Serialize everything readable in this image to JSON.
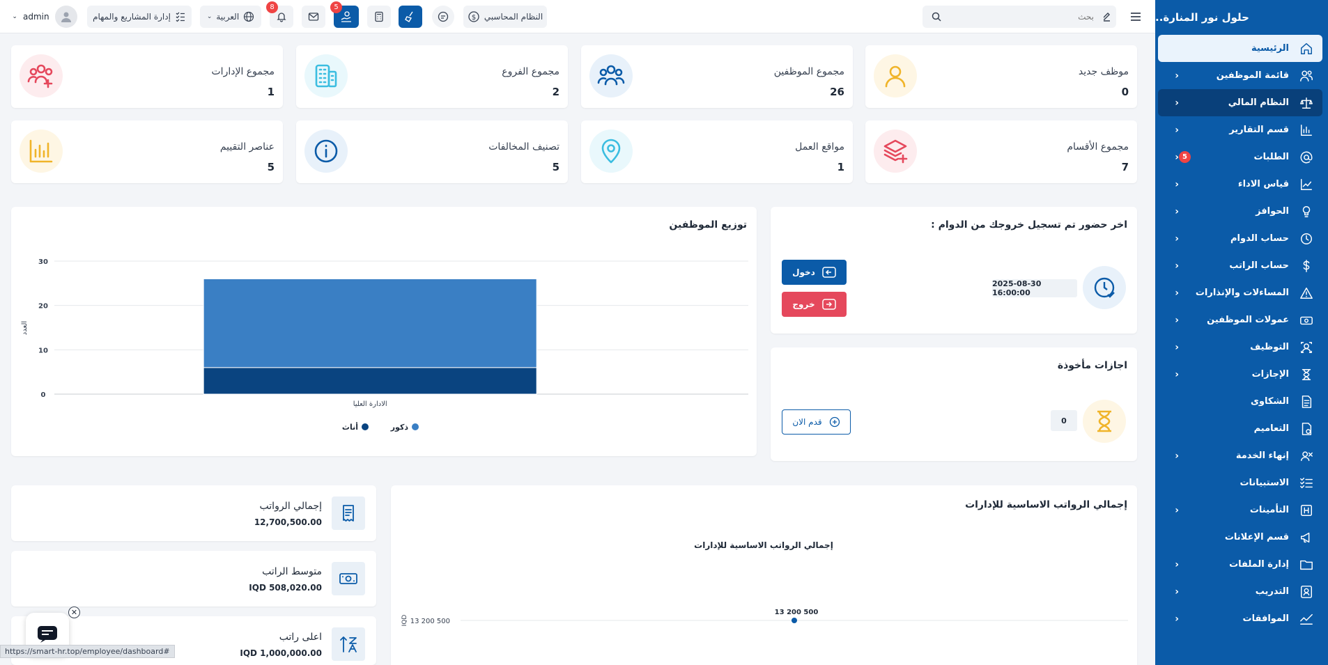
{
  "sidebar": {
    "brand": "حلول نور المنارة..",
    "items": [
      {
        "label": "الرئيسية",
        "icon": "home-icon",
        "chevron": false,
        "state": "active"
      },
      {
        "label": "قائمة الموظفين",
        "icon": "users-icon",
        "chevron": true
      },
      {
        "label": "النظام المالي",
        "icon": "scale-icon",
        "chevron": true,
        "state": "selected"
      },
      {
        "label": "قسم التقارير",
        "icon": "report-chart-icon",
        "chevron": true
      },
      {
        "label": "الطلبات",
        "icon": "at-icon",
        "chevron": true,
        "badge": "5"
      },
      {
        "label": "قياس الاداء",
        "icon": "trend-up-icon",
        "chevron": true
      },
      {
        "label": "الحوافز",
        "icon": "bulb-icon",
        "chevron": true
      },
      {
        "label": "حساب الدوام",
        "icon": "clock-icon",
        "chevron": true
      },
      {
        "label": "حساب الراتب",
        "icon": "dollar-icon",
        "chevron": true
      },
      {
        "label": "المساءلات والإنذارات",
        "icon": "warning-icon",
        "chevron": true
      },
      {
        "label": "عمولات الموظفين",
        "icon": "cash-icon",
        "chevron": true
      },
      {
        "label": "التوظيف",
        "icon": "hire-icon",
        "chevron": true
      },
      {
        "label": "الإجازات",
        "icon": "hourglass-icon",
        "chevron": true
      },
      {
        "label": "الشكاوى",
        "icon": "document-icon",
        "chevron": false
      },
      {
        "label": "التعاميم",
        "icon": "memo-icon",
        "chevron": false
      },
      {
        "label": "إنهاء الخدمة",
        "icon": "end-service-icon",
        "chevron": true
      },
      {
        "label": "الاستبيانات",
        "icon": "checklist-icon",
        "chevron": false
      },
      {
        "label": "التأمينات",
        "icon": "insurance-icon",
        "chevron": true
      },
      {
        "label": "قسم الإعلانات",
        "icon": "megaphone-icon",
        "chevron": false
      },
      {
        "label": "إدارة الملفات",
        "icon": "folder-icon",
        "chevron": true
      },
      {
        "label": "التدريب",
        "icon": "training-icon",
        "chevron": true
      },
      {
        "label": "الموافقات",
        "icon": "approval-icon",
        "chevron": true
      }
    ]
  },
  "topbar": {
    "search_placeholder": "بحث",
    "accounting_label": "النظام المحاسبي",
    "language_label": "العربية",
    "projects_label": "إدارة المشاريع والمهام",
    "user_label": "admin",
    "notifications_count": "8",
    "tasks_count": "5"
  },
  "stats": [
    {
      "title": "موظف جديد",
      "value": "0",
      "icon": "user-icon",
      "bg": "#fef6e4",
      "color": "#f0b429"
    },
    {
      "title": "مجموع الموظفين",
      "value": "26",
      "icon": "team-icon",
      "bg": "#e8f1fa",
      "color": "#0b5ba8"
    },
    {
      "title": "مجموع الفروع",
      "value": "2",
      "icon": "building-icon",
      "bg": "#e9f8fc",
      "color": "#3bbde0"
    },
    {
      "title": "مجموع الإدارات",
      "value": "1",
      "icon": "team-add-icon",
      "bg": "#fdecee",
      "color": "#e5485c"
    },
    {
      "title": "مجموع الأقسام",
      "value": "7",
      "icon": "layers-add-icon",
      "bg": "#fdecee",
      "color": "#e5485c"
    },
    {
      "title": "مواقع العمل",
      "value": "1",
      "icon": "map-pin-icon",
      "bg": "#e9f8fc",
      "color": "#3bbde0"
    },
    {
      "title": "تصنيف المخالفات",
      "value": "5",
      "icon": "info-icon",
      "bg": "#e8f1fa",
      "color": "#0b5ba8"
    },
    {
      "title": "عناصر التقييم",
      "value": "5",
      "icon": "bar-chart-icon",
      "bg": "#fef6e4",
      "color": "#f0b429"
    }
  ],
  "attendance": {
    "title": "اخر حضور تم تسجيل خروجك من الدوام :",
    "datetime": "2025-08-30 16:00:00",
    "checkin_label": "دخول",
    "checkout_label": "خروج"
  },
  "leaves": {
    "title": "اجازات مأخوذة",
    "count": "0",
    "apply_label": "قدم الان"
  },
  "employee_distribution": {
    "title": "توزيع الموظفين"
  },
  "salary_cards": [
    {
      "title": "إجمالي الرواتب",
      "value": "12,700,500.00",
      "icon": "receipt-icon"
    },
    {
      "title": "متوسط الراتب",
      "value": "IQD 508,020.00",
      "icon": "money-icon"
    },
    {
      "title": "اعلى راتب",
      "value": "IQD 1,000,000.00",
      "icon": "sort-up-icon"
    }
  ],
  "salary_panel": {
    "title": "إجمالي الرواتب الاساسية للإدارات"
  },
  "status_url": "https://smart-hr.top/employee/dashboard#",
  "chart_data": [
    {
      "type": "bar",
      "stacked": true,
      "categories": [
        "الادارة العليا"
      ],
      "series": [
        {
          "name": "أناث",
          "values": [
            6
          ],
          "color": "#0a4480"
        },
        {
          "name": "ذكور",
          "values": [
            20
          ],
          "color": "#3a7fc4"
        }
      ],
      "title": "",
      "xlabel": "",
      "ylabel": "العدد",
      "ylim": [
        0,
        30
      ],
      "yticks": [
        "0",
        "10",
        "20",
        "30"
      ],
      "grid": true,
      "legend": "bottom"
    },
    {
      "type": "line",
      "title": "إجمالي الرواتب الاساسية للإدارات",
      "ylabel": "IQD",
      "ytick_label": "13 200 500",
      "series": [
        {
          "values": [
            13200500
          ],
          "point_label": "13 200 500",
          "color": "#0b5ba8"
        }
      ]
    }
  ]
}
